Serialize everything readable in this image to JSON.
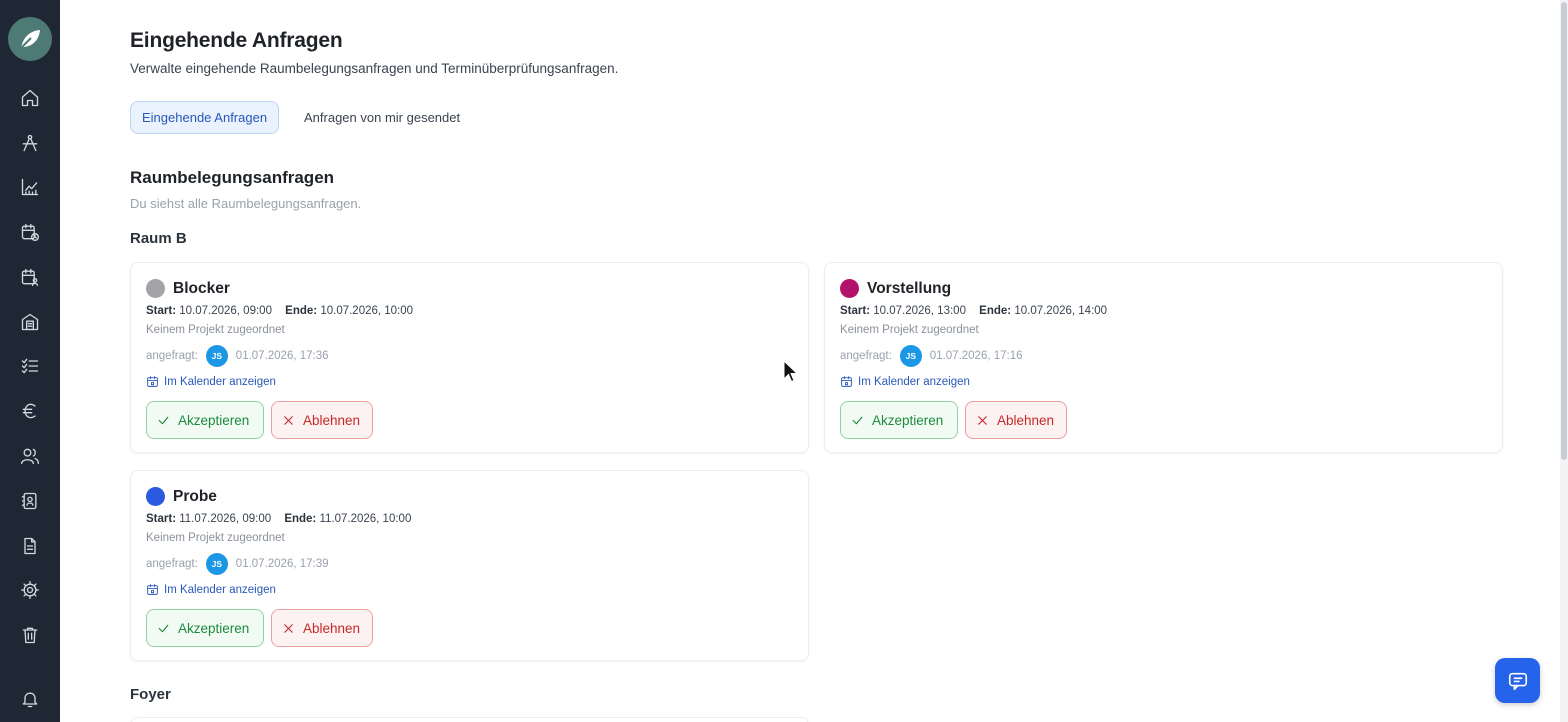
{
  "header": {
    "title": "Eingehende Anfragen",
    "subtitle": "Verwalte eingehende Raumbelegungsanfragen und Terminüberprüfungsanfragen."
  },
  "tabs": [
    {
      "label": "Eingehende Anfragen",
      "active": true
    },
    {
      "label": "Anfragen von mir gesendet",
      "active": false
    }
  ],
  "section": {
    "title": "Raumbelegungsanfragen",
    "subtitle": "Du siehst alle Raumbelegungsanfragen."
  },
  "labels": {
    "start": "Start:",
    "end": "Ende:",
    "requested": "angefragt:",
    "calendar_link": "Im Kalender anzeigen",
    "accept": "Akzeptieren",
    "reject": "Ablehnen"
  },
  "groups": [
    {
      "name": "Raum B",
      "requests": [
        {
          "title": "Blocker",
          "color": "#a3a3a8",
          "start": "10.07.2026, 09:00",
          "end": "10.07.2026, 10:00",
          "project": "Keinem Projekt zugeordnet",
          "initials": "JS",
          "requested_at": "01.07.2026, 17:36"
        },
        {
          "title": "Vorstellung",
          "color": "#b3126c",
          "start": "10.07.2026, 13:00",
          "end": "10.07.2026, 14:00",
          "project": "Keinem Projekt zugeordnet",
          "initials": "JS",
          "requested_at": "01.07.2026, 17:16"
        },
        {
          "title": "Probe",
          "color": "#2b59e0",
          "start": "11.07.2026, 09:00",
          "end": "11.07.2026, 10:00",
          "project": "Keinem Projekt zugeordnet",
          "initials": "JS",
          "requested_at": "01.07.2026, 17:39"
        }
      ]
    },
    {
      "name": "Foyer",
      "requests": []
    }
  ],
  "sidebar": {
    "icons": [
      "home-icon",
      "compass-icon",
      "chart-icon",
      "calendar-clock-icon",
      "calendar-user-icon",
      "building-icon",
      "checklist-icon",
      "euro-icon",
      "users-icon",
      "contacts-icon",
      "document-icon",
      "gear-icon",
      "trash-icon",
      "bell-icon"
    ]
  },
  "colors": {
    "sidebar_bg": "#1e2733",
    "accent": "#2a58b8",
    "accept": "#1d8a3d",
    "reject": "#c62828"
  }
}
